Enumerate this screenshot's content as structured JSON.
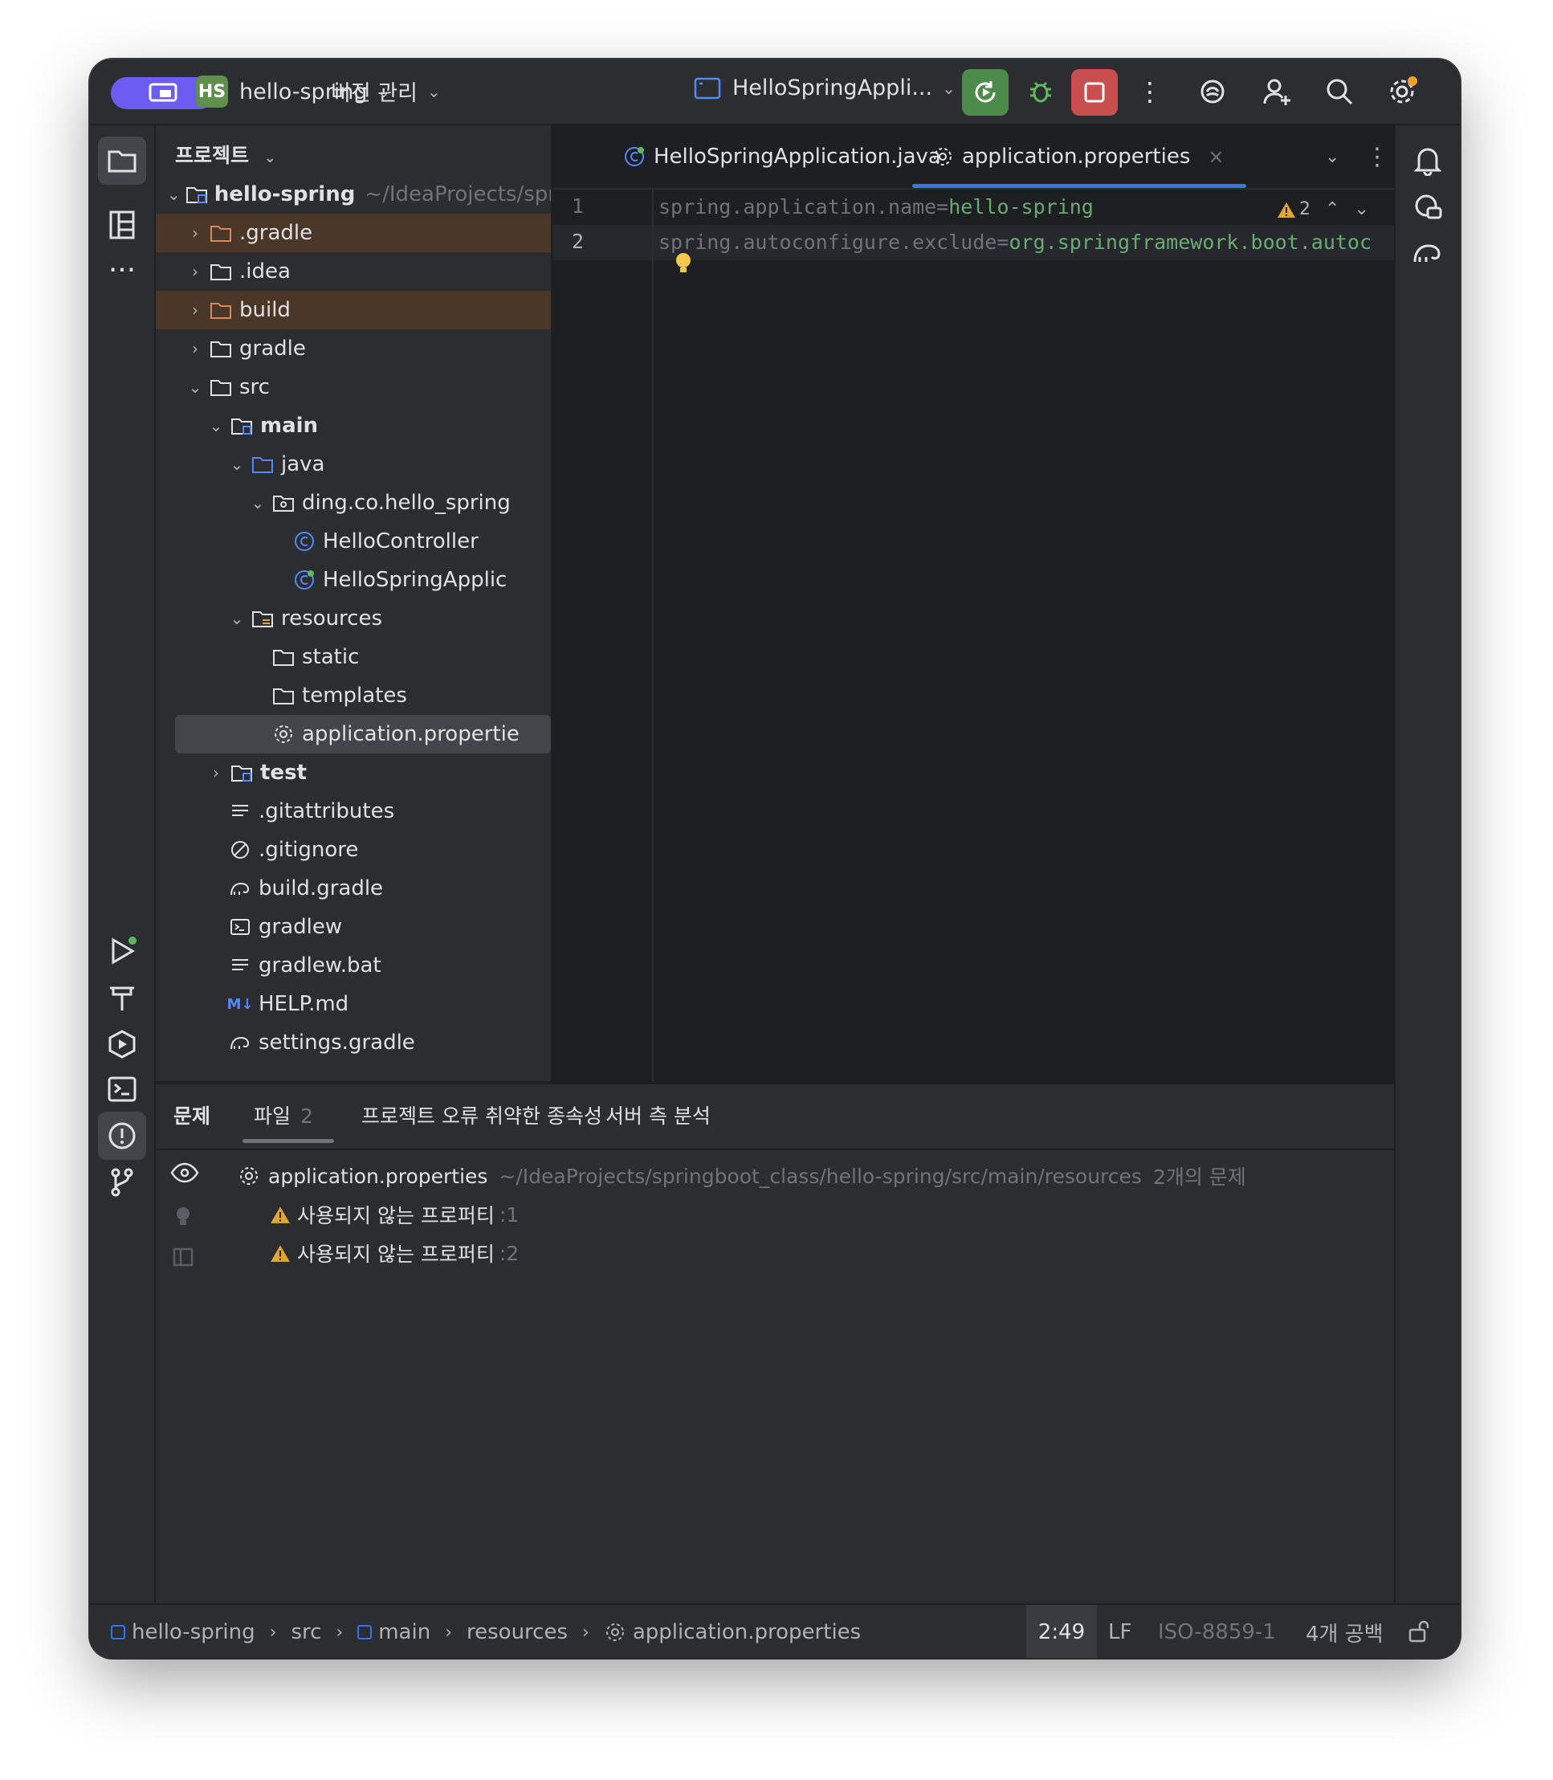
{
  "titlebar": {
    "project_badge": "HS",
    "project_name": "hello-spring",
    "vcs_label": "버전 관리",
    "run_config": "HelloSpringAppli..."
  },
  "project_panel": {
    "header": "프로젝트",
    "root": {
      "name": "hello-spring",
      "path": "~/IdeaProjects/spri"
    },
    "items": [
      {
        "label": ".gradle"
      },
      {
        "label": ".idea"
      },
      {
        "label": "build"
      },
      {
        "label": "gradle"
      },
      {
        "label": "src"
      },
      {
        "label": "main"
      },
      {
        "label": "java"
      },
      {
        "label": "ding.co.hello_spring"
      },
      {
        "label": "HelloController"
      },
      {
        "label": "HelloSpringApplic"
      },
      {
        "label": "resources"
      },
      {
        "label": "static"
      },
      {
        "label": "templates"
      },
      {
        "label": "application.propertie"
      },
      {
        "label": "test"
      },
      {
        "label": ".gitattributes"
      },
      {
        "label": ".gitignore"
      },
      {
        "label": "build.gradle"
      },
      {
        "label": "gradlew"
      },
      {
        "label": "gradlew.bat"
      },
      {
        "label": "HELP.md"
      },
      {
        "label": "settings.gradle"
      }
    ]
  },
  "editor": {
    "tabs": [
      {
        "label": "HelloSpringApplication.java"
      },
      {
        "label": "application.properties"
      }
    ],
    "warning_count": "2",
    "lines": [
      {
        "num": "1",
        "key": "spring.application.name=",
        "value": "hello-spring"
      },
      {
        "num": "2",
        "key": "spring.autoconfigure.exclude=",
        "value": "org.springframework.boot.autoc"
      }
    ]
  },
  "problems": {
    "tabs": [
      {
        "label": "문제"
      },
      {
        "label": "파일",
        "count": "2"
      },
      {
        "label": "프로젝트 오류"
      },
      {
        "label": "취약한 종속성"
      },
      {
        "label": "서버 측 분석"
      }
    ],
    "file": {
      "name": "application.properties",
      "path": "~/IdeaProjects/springboot_class/hello-spring/src/main/resources",
      "summary": "2개의 문제"
    },
    "issues": [
      {
        "text": "사용되지 않는 프로퍼티",
        "loc": ":1"
      },
      {
        "text": "사용되지 않는 프로퍼티",
        "loc": ":2"
      }
    ]
  },
  "statusbar": {
    "breadcrumb": [
      "hello-spring",
      "src",
      "main",
      "resources",
      "application.properties"
    ],
    "position": "2:49",
    "line_sep": "LF",
    "encoding": "ISO-8859-1",
    "indent": "4개 공백"
  },
  "colors": {
    "accent": "#3574f0",
    "run_green": "#4c8b4a",
    "stop_red": "#c94f4f",
    "string_green": "#6aab73",
    "warning": "#e0a737"
  }
}
